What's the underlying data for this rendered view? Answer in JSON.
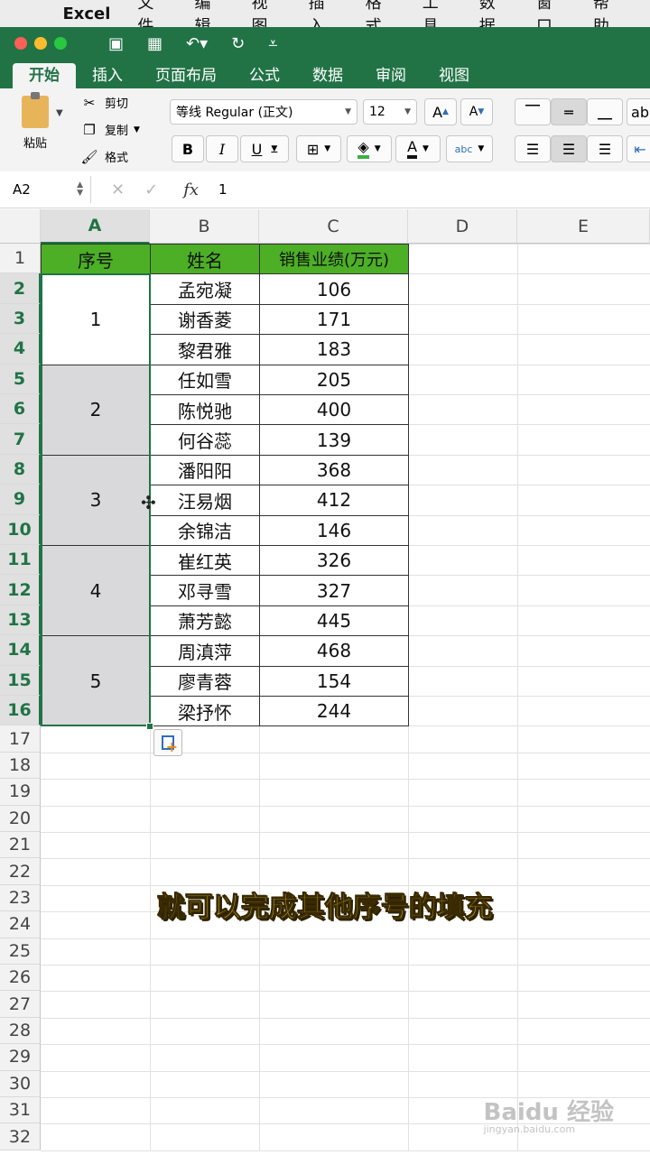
{
  "menubar": {
    "app": "Excel",
    "items": [
      "文件",
      "编辑",
      "视图",
      "插入",
      "格式",
      "工具",
      "数据",
      "窗口",
      "帮助"
    ]
  },
  "ribbon_tabs": [
    "开始",
    "插入",
    "页面布局",
    "公式",
    "数据",
    "审阅",
    "视图"
  ],
  "ribbon": {
    "paste": "粘贴",
    "cut": "剪切",
    "copy": "复制",
    "format_painter": "格式",
    "font_name": "等线 Regular (正文)",
    "font_size": "12",
    "bold": "B",
    "italic": "I",
    "underline": "U",
    "grow_font": "A",
    "shrink_font": "A",
    "font_color": "A",
    "abc": "abc"
  },
  "formula_bar": {
    "name_box": "A2",
    "fx": "fx",
    "value": "1"
  },
  "columns": [
    "A",
    "B",
    "C",
    "D",
    "E"
  ],
  "row_numbers": [
    "1",
    "2",
    "3",
    "4",
    "5",
    "6",
    "7",
    "8",
    "9",
    "10",
    "11",
    "12",
    "13",
    "14",
    "15",
    "16",
    "17",
    "18",
    "19",
    "20",
    "21",
    "22",
    "23",
    "24",
    "25",
    "26",
    "27",
    "28",
    "29",
    "30",
    "31",
    "32"
  ],
  "table": {
    "headers": [
      "序号",
      "姓名",
      "销售业绩(万元)"
    ],
    "groups": [
      "1",
      "2",
      "3",
      "4",
      "5"
    ],
    "names": [
      "孟宛凝",
      "谢香菱",
      "黎君雅",
      "任如雪",
      "陈悦驰",
      "何谷蕊",
      "潘阳阳",
      "汪易烟",
      "余锦洁",
      "崔红英",
      "邓寻雪",
      "萧芳懿",
      "周滇萍",
      "廖青蓉",
      "梁抒怀"
    ],
    "sales": [
      "106",
      "171",
      "183",
      "205",
      "400",
      "139",
      "368",
      "412",
      "146",
      "326",
      "327",
      "445",
      "468",
      "154",
      "244"
    ]
  },
  "subtitle": "就可以完成其他序号的填充",
  "watermark": {
    "main": "Baidu 经验",
    "sub": "jingyan.baidu.com"
  },
  "colors": {
    "excel_green": "#217346",
    "header_fill": "#4caf25",
    "merge_shade": "#d9d9dc",
    "subtitle": "#f5d53c"
  }
}
